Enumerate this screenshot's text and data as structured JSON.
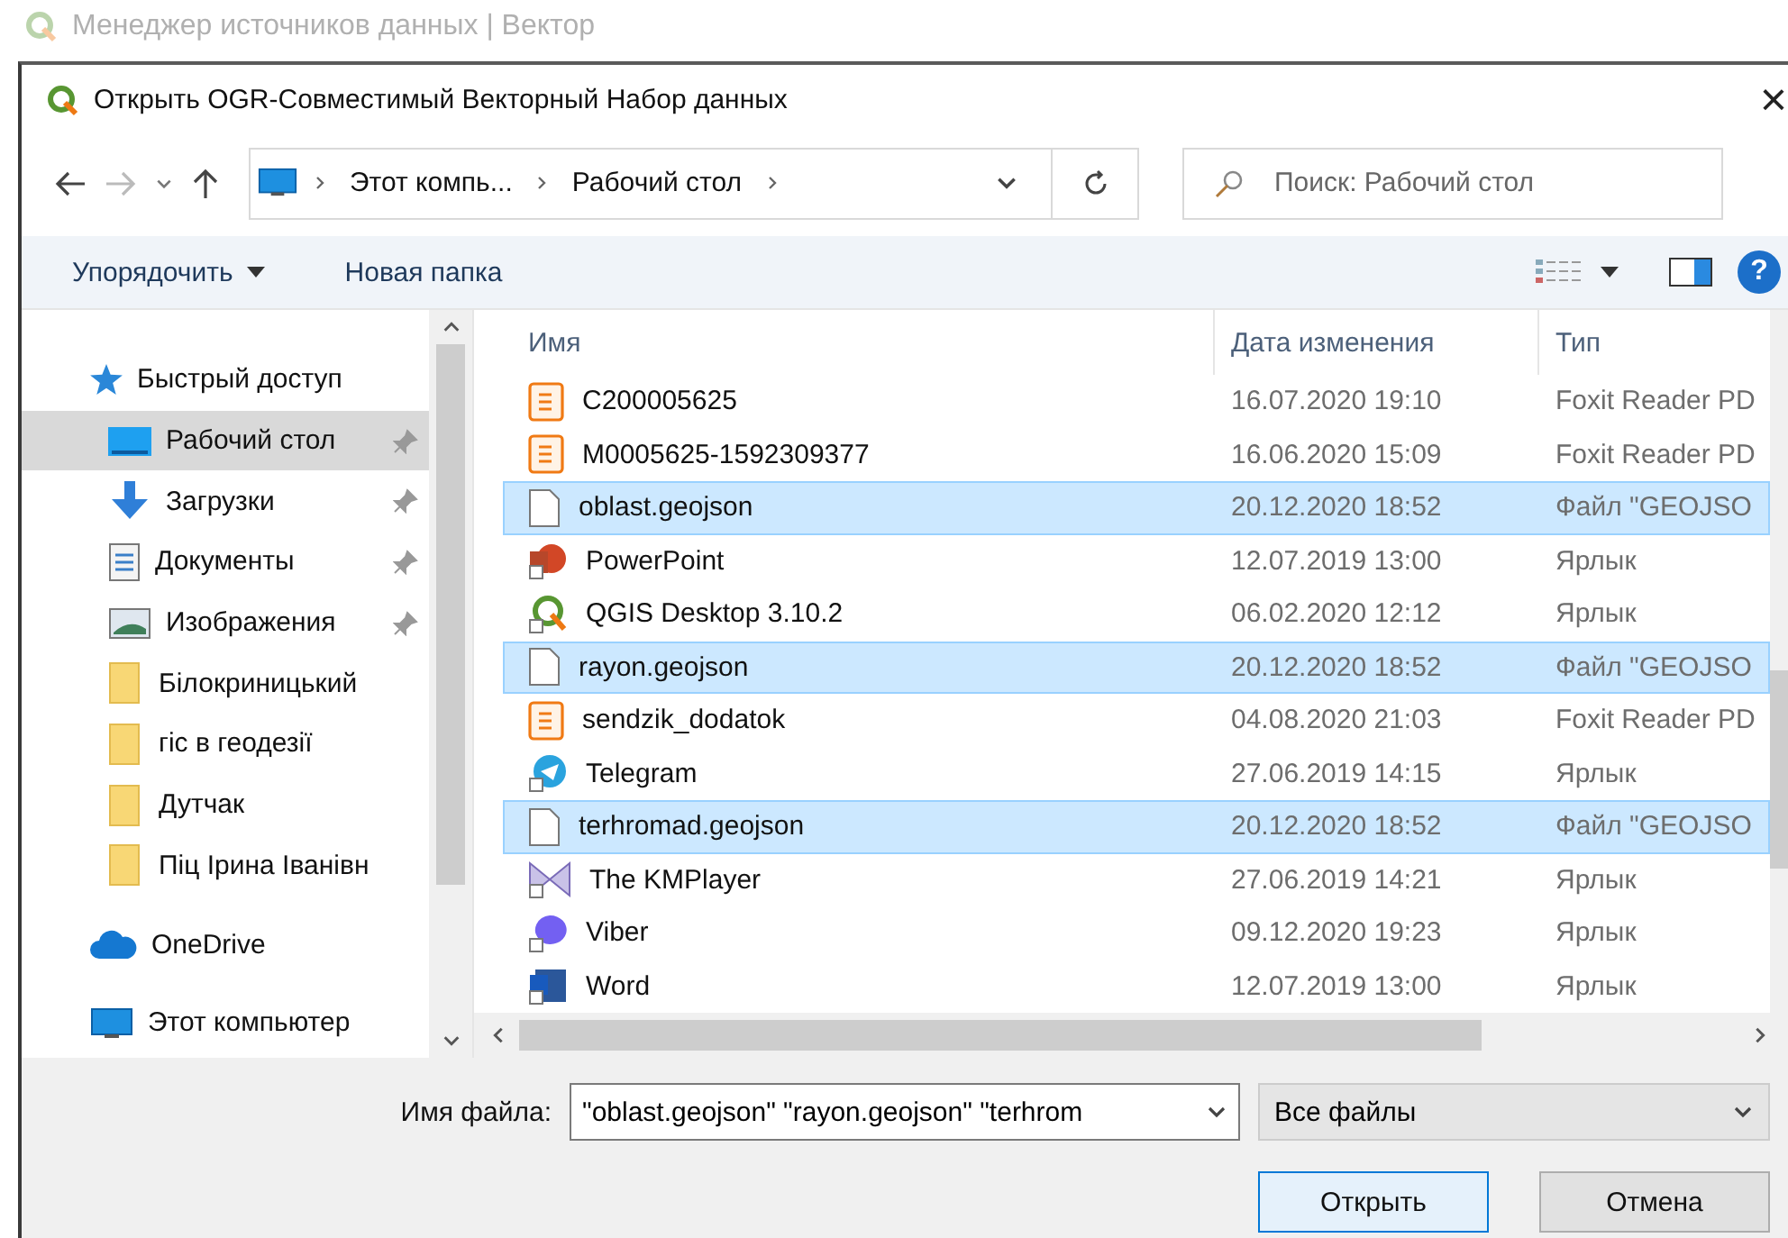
{
  "parent_window": {
    "title": "Менеджер источников данных | Вектор"
  },
  "dialog": {
    "title": "Открыть OGR-Совместимый Векторный Набор данных",
    "close": "×"
  },
  "address_bar": {
    "breadcrumbs": [
      "Этот компь...",
      "Рабочий стол"
    ]
  },
  "search": {
    "placeholder": "Поиск: Рабочий стол"
  },
  "toolbar": {
    "organize": "Упорядочить",
    "new_folder": "Новая папка",
    "help": "?"
  },
  "sidebar": {
    "items": [
      {
        "label": "Быстрый доступ",
        "kind": "star",
        "selected": false,
        "pinned": false,
        "children": [
          {
            "label": "Рабочий стол",
            "kind": "desktop",
            "selected": true,
            "pinned": true
          },
          {
            "label": "Загрузки",
            "kind": "download",
            "selected": false,
            "pinned": true
          },
          {
            "label": "Документы",
            "kind": "documents",
            "selected": false,
            "pinned": true
          },
          {
            "label": "Изображения",
            "kind": "pictures",
            "selected": false,
            "pinned": true
          },
          {
            "label": "Білокриницький",
            "kind": "folder",
            "selected": false,
            "pinned": false
          },
          {
            "label": "гіс в геодезії",
            "kind": "folder",
            "selected": false,
            "pinned": false
          },
          {
            "label": "Дутчак",
            "kind": "folder",
            "selected": false,
            "pinned": false
          },
          {
            "label": "Піц Ірина Іванівн",
            "kind": "folder",
            "selected": false,
            "pinned": false
          }
        ]
      },
      {
        "label": "OneDrive",
        "kind": "cloud",
        "selected": false,
        "pinned": false
      },
      {
        "label": "Этот компьютер",
        "kind": "computer",
        "selected": false,
        "pinned": false
      }
    ]
  },
  "table": {
    "columns": [
      "Имя",
      "Дата изменения",
      "Тип"
    ],
    "rows": [
      {
        "name": "C200005625",
        "date": "16.07.2020 19:10",
        "type": "Foxit Reader PD",
        "kind": "pdf",
        "selected": false
      },
      {
        "name": "M0005625-1592309377",
        "date": "16.06.2020 15:09",
        "type": "Foxit Reader PD",
        "kind": "pdf",
        "selected": false
      },
      {
        "name": "oblast.geojson",
        "date": "20.12.2020 18:52",
        "type": "Файл \"GEOJSO",
        "kind": "file",
        "selected": true
      },
      {
        "name": "PowerPoint",
        "date": "12.07.2019 13:00",
        "type": "Ярлык",
        "kind": "powerpoint",
        "selected": false
      },
      {
        "name": "QGIS Desktop 3.10.2",
        "date": "06.02.2020 12:12",
        "type": "Ярлык",
        "kind": "qgis",
        "selected": false
      },
      {
        "name": "rayon.geojson",
        "date": "20.12.2020 18:52",
        "type": "Файл \"GEOJSO",
        "kind": "file",
        "selected": true
      },
      {
        "name": "sendzik_dodatok",
        "date": "04.08.2020 21:03",
        "type": "Foxit Reader PD",
        "kind": "pdf",
        "selected": false
      },
      {
        "name": "Telegram",
        "date": "27.06.2019 14:15",
        "type": "Ярлык",
        "kind": "telegram",
        "selected": false
      },
      {
        "name": "terhromad.geojson",
        "date": "20.12.2020 18:52",
        "type": "Файл \"GEOJSO",
        "kind": "file",
        "selected": true
      },
      {
        "name": "The KMPlayer",
        "date": "27.06.2019 14:21",
        "type": "Ярлык",
        "kind": "player",
        "selected": false
      },
      {
        "name": "Viber",
        "date": "09.12.2020 19:23",
        "type": "Ярлык",
        "kind": "viber",
        "selected": false
      },
      {
        "name": "Word",
        "date": "12.07.2019 13:00",
        "type": "Ярлык",
        "kind": "word",
        "selected": false
      }
    ]
  },
  "footer": {
    "filename_label": "Имя файла:",
    "filename_value": "\"oblast.geojson\" \"rayon.geojson\" \"terhrom",
    "filter": "Все файлы",
    "buttons": [
      "Открыть",
      "Отмена"
    ]
  }
}
